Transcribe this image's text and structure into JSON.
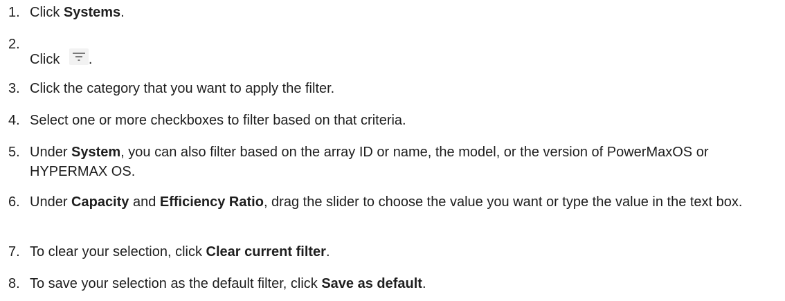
{
  "steps": [
    {
      "number": "1.",
      "parts": [
        {
          "text": "Click ",
          "bold": false
        },
        {
          "text": "Systems",
          "bold": true
        },
        {
          "text": ".",
          "bold": false
        }
      ]
    },
    {
      "number": "2.",
      "parts": [
        {
          "text": "Click ",
          "bold": false
        },
        {
          "icon": "filter-icon"
        },
        {
          "text": ".",
          "bold": false
        }
      ]
    },
    {
      "number": "3.",
      "parts": [
        {
          "text": "Click the category that you want to apply the filter.",
          "bold": false
        }
      ]
    },
    {
      "number": "4.",
      "parts": [
        {
          "text": "Select one or more checkboxes to filter based on that criteria.",
          "bold": false
        }
      ]
    },
    {
      "number": "5.",
      "parts": [
        {
          "text": "Under ",
          "bold": false
        },
        {
          "text": "System",
          "bold": true
        },
        {
          "text": ", you can also filter based on the array ID or name, the model, or the version of PowerMaxOS or HYPERMAX OS.",
          "bold": false
        }
      ]
    },
    {
      "number": "6.",
      "parts": [
        {
          "text": "Under ",
          "bold": false
        },
        {
          "text": "Capacity",
          "bold": true
        },
        {
          "text": " and ",
          "bold": false
        },
        {
          "text": "Efficiency Ratio",
          "bold": true
        },
        {
          "text": ", drag the slider to choose the value you want or type the value in the text box.",
          "bold": false
        }
      ]
    },
    {
      "number": "7.",
      "parts": [
        {
          "text": "To clear your selection, click ",
          "bold": false
        },
        {
          "text": "Clear current filter",
          "bold": true
        },
        {
          "text": ".",
          "bold": false
        }
      ]
    },
    {
      "number": "8.",
      "parts": [
        {
          "text": "To save your selection as the default filter, click ",
          "bold": false
        },
        {
          "text": "Save as default",
          "bold": true
        },
        {
          "text": ".",
          "bold": false
        }
      ]
    }
  ]
}
